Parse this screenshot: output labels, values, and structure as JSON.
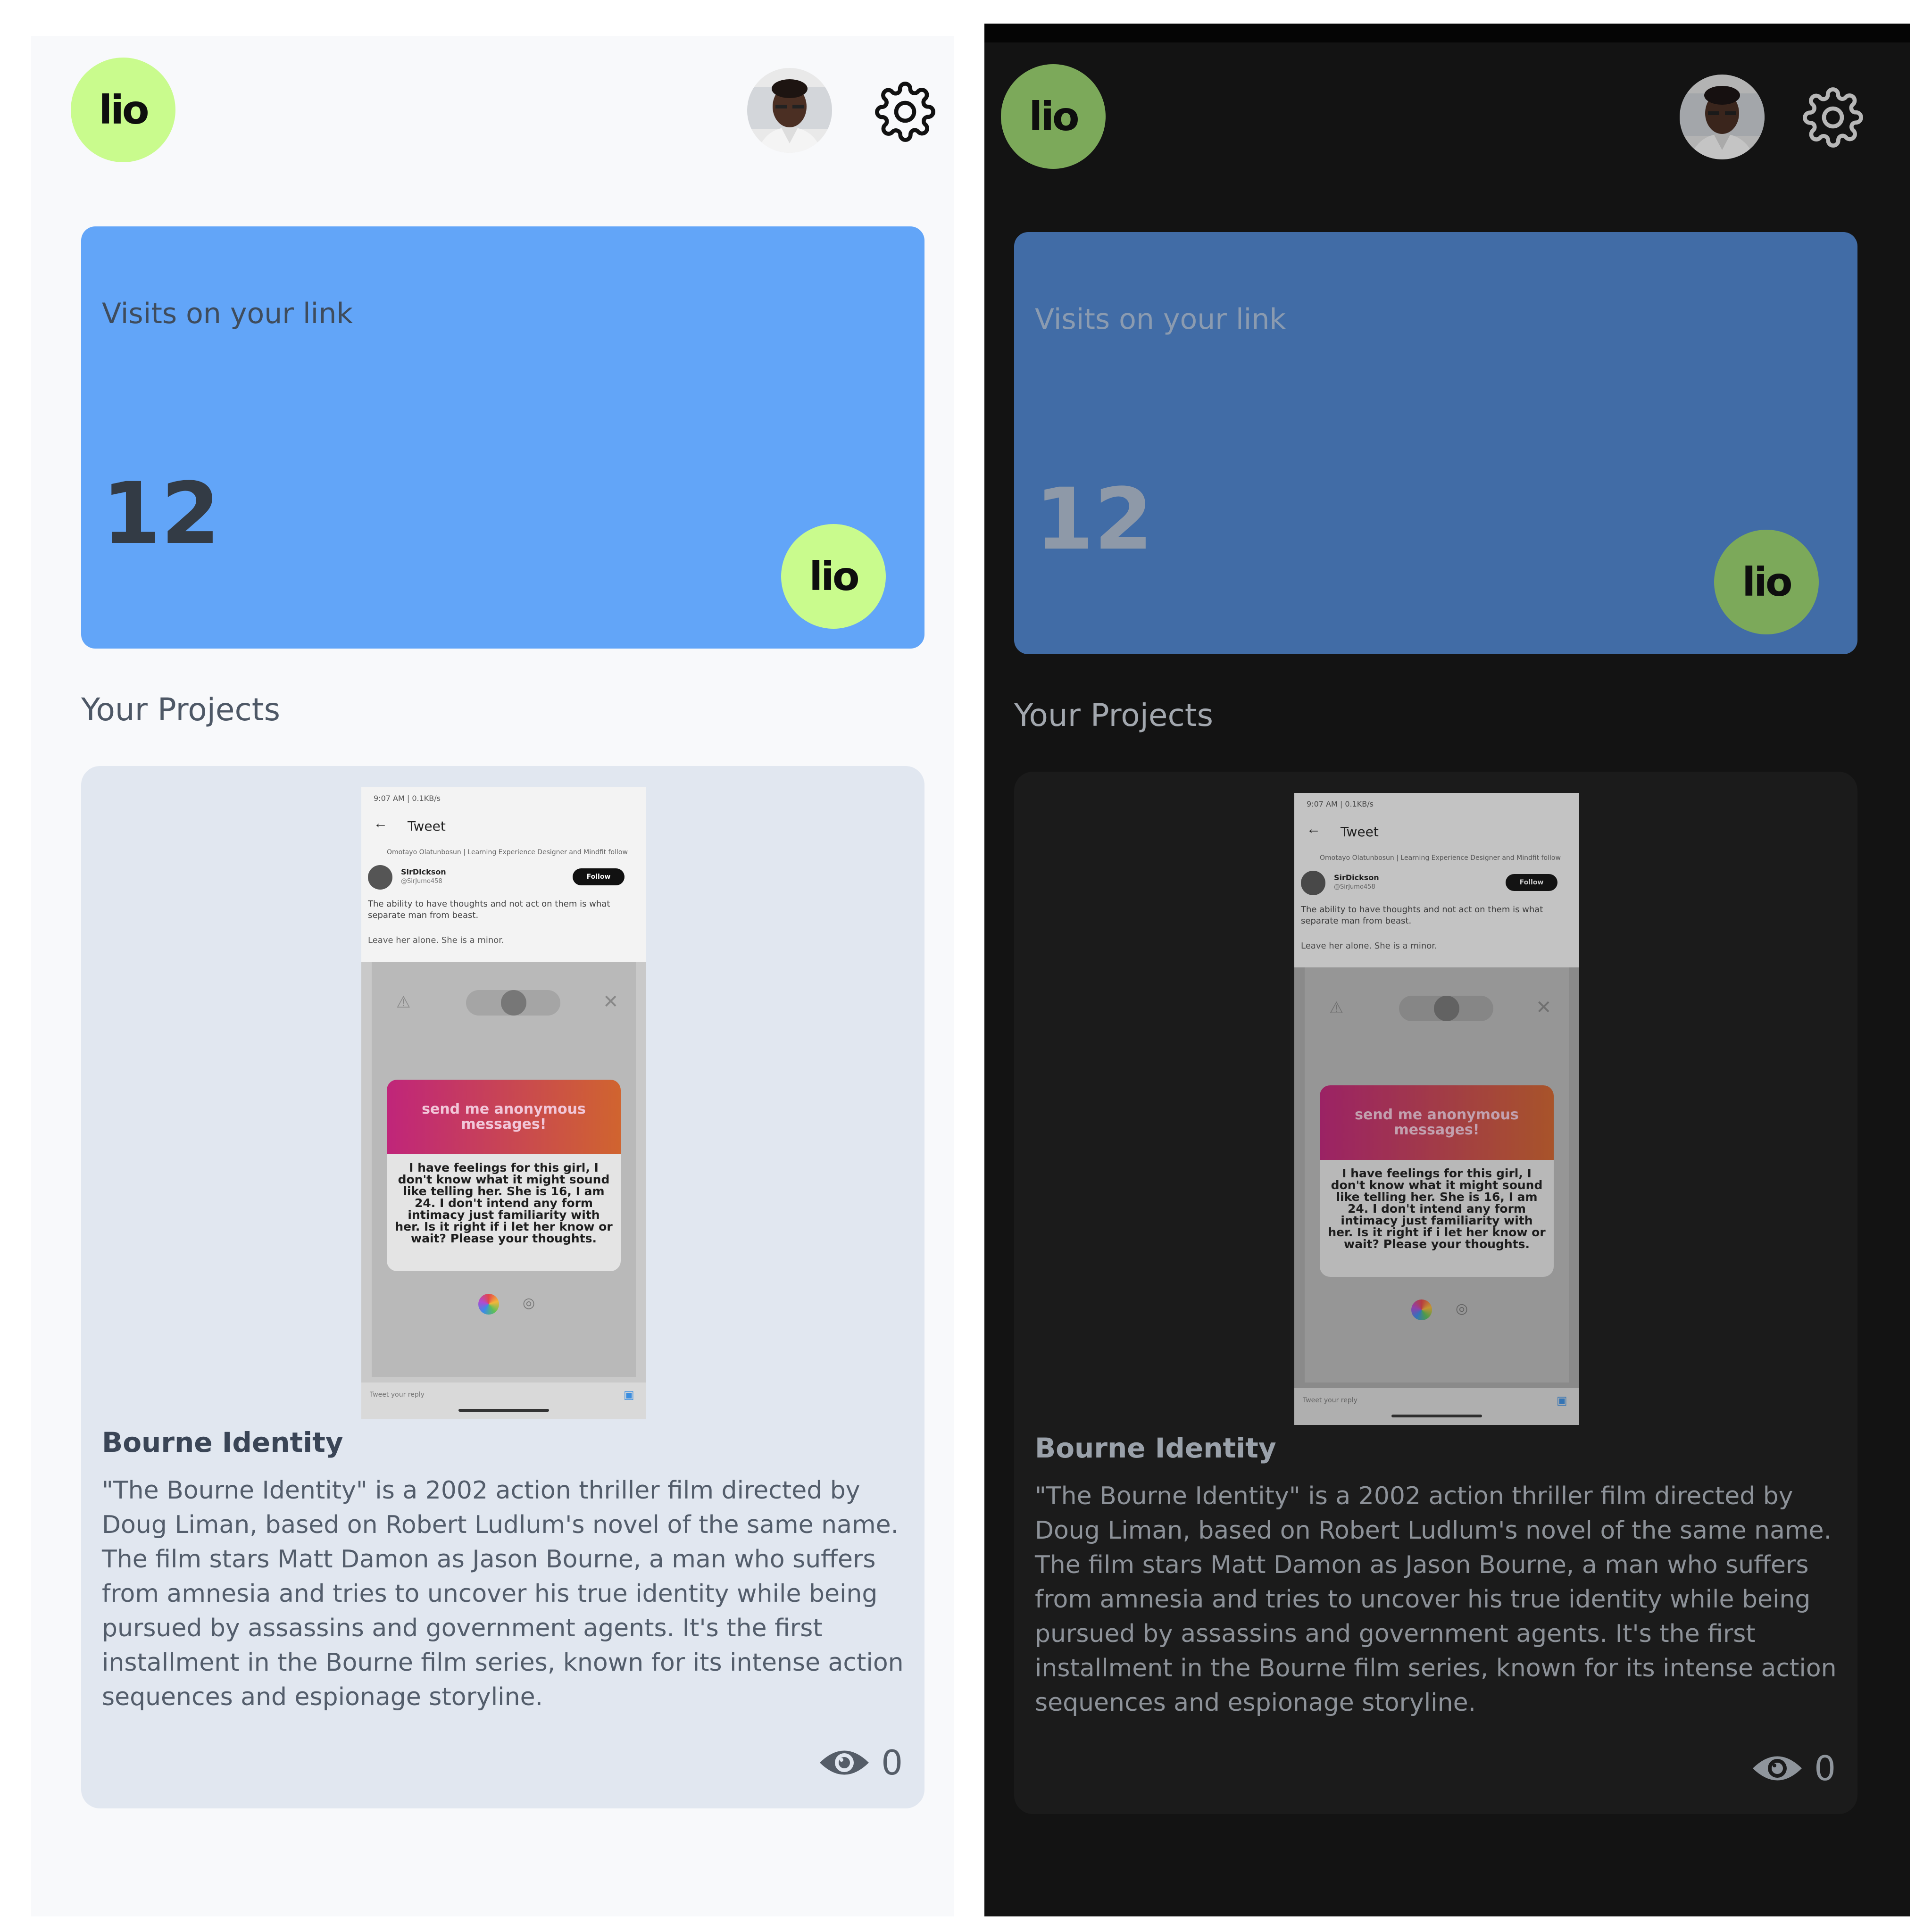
{
  "app": {
    "logo_text": "lio"
  },
  "header": {
    "avatar_alt": "",
    "settings_icon": "gear-icon"
  },
  "visits": {
    "label": "Visits on your link",
    "count": "12"
  },
  "projects": {
    "section_title": "Your Projects",
    "items": [
      {
        "title": "Bourne Identity",
        "description": "\"The Bourne Identity\" is a 2002 action thriller film directed by Doug Liman, based on Robert Ludlum's novel of the same name. The film stars Matt Damon as Jason Bourne, a man who suffers from amnesia and tries to uncover his true identity while being pursued by assassins and government agents. It's the first installment in the Bourne film series, known for its intense action sequences and espionage storyline.",
        "views": "0",
        "thumbnail": {
          "status": "9:07 AM | 0.1KB/s",
          "screen_title": "Tweet",
          "retweet_line": "Omotayo Olatunbosun | Learning Experience Designer and Mindfit follow",
          "user": "SirDickson",
          "handle": "@SirJumo458",
          "follow_label": "Follow",
          "tweet_text": "The ability to have thoughts and not act on them is what separate man from beast.",
          "tweet_text_2": "Leave her alone. She is a minor.",
          "prompt_header": "send me anonymous messages!",
          "prompt_body": "I have feelings for this girl, I don't know what it might sound like telling her. She is 16, I am 24. I don't intend any form intimacy just familiarity with her. Is it right if i let her know or wait? Please your thoughts.",
          "reply_placeholder": "Tweet your reply"
        }
      }
    ]
  },
  "themes": {
    "light": {
      "background": "#f8f9fb",
      "accent": "#c9fb8d",
      "card": "#62a5f8",
      "project_card": "#e1e7f0"
    },
    "dark": {
      "background": "#131313",
      "accent": "#7ca95a",
      "card": "#416ca6",
      "project_card": "#1b1b1b"
    }
  }
}
